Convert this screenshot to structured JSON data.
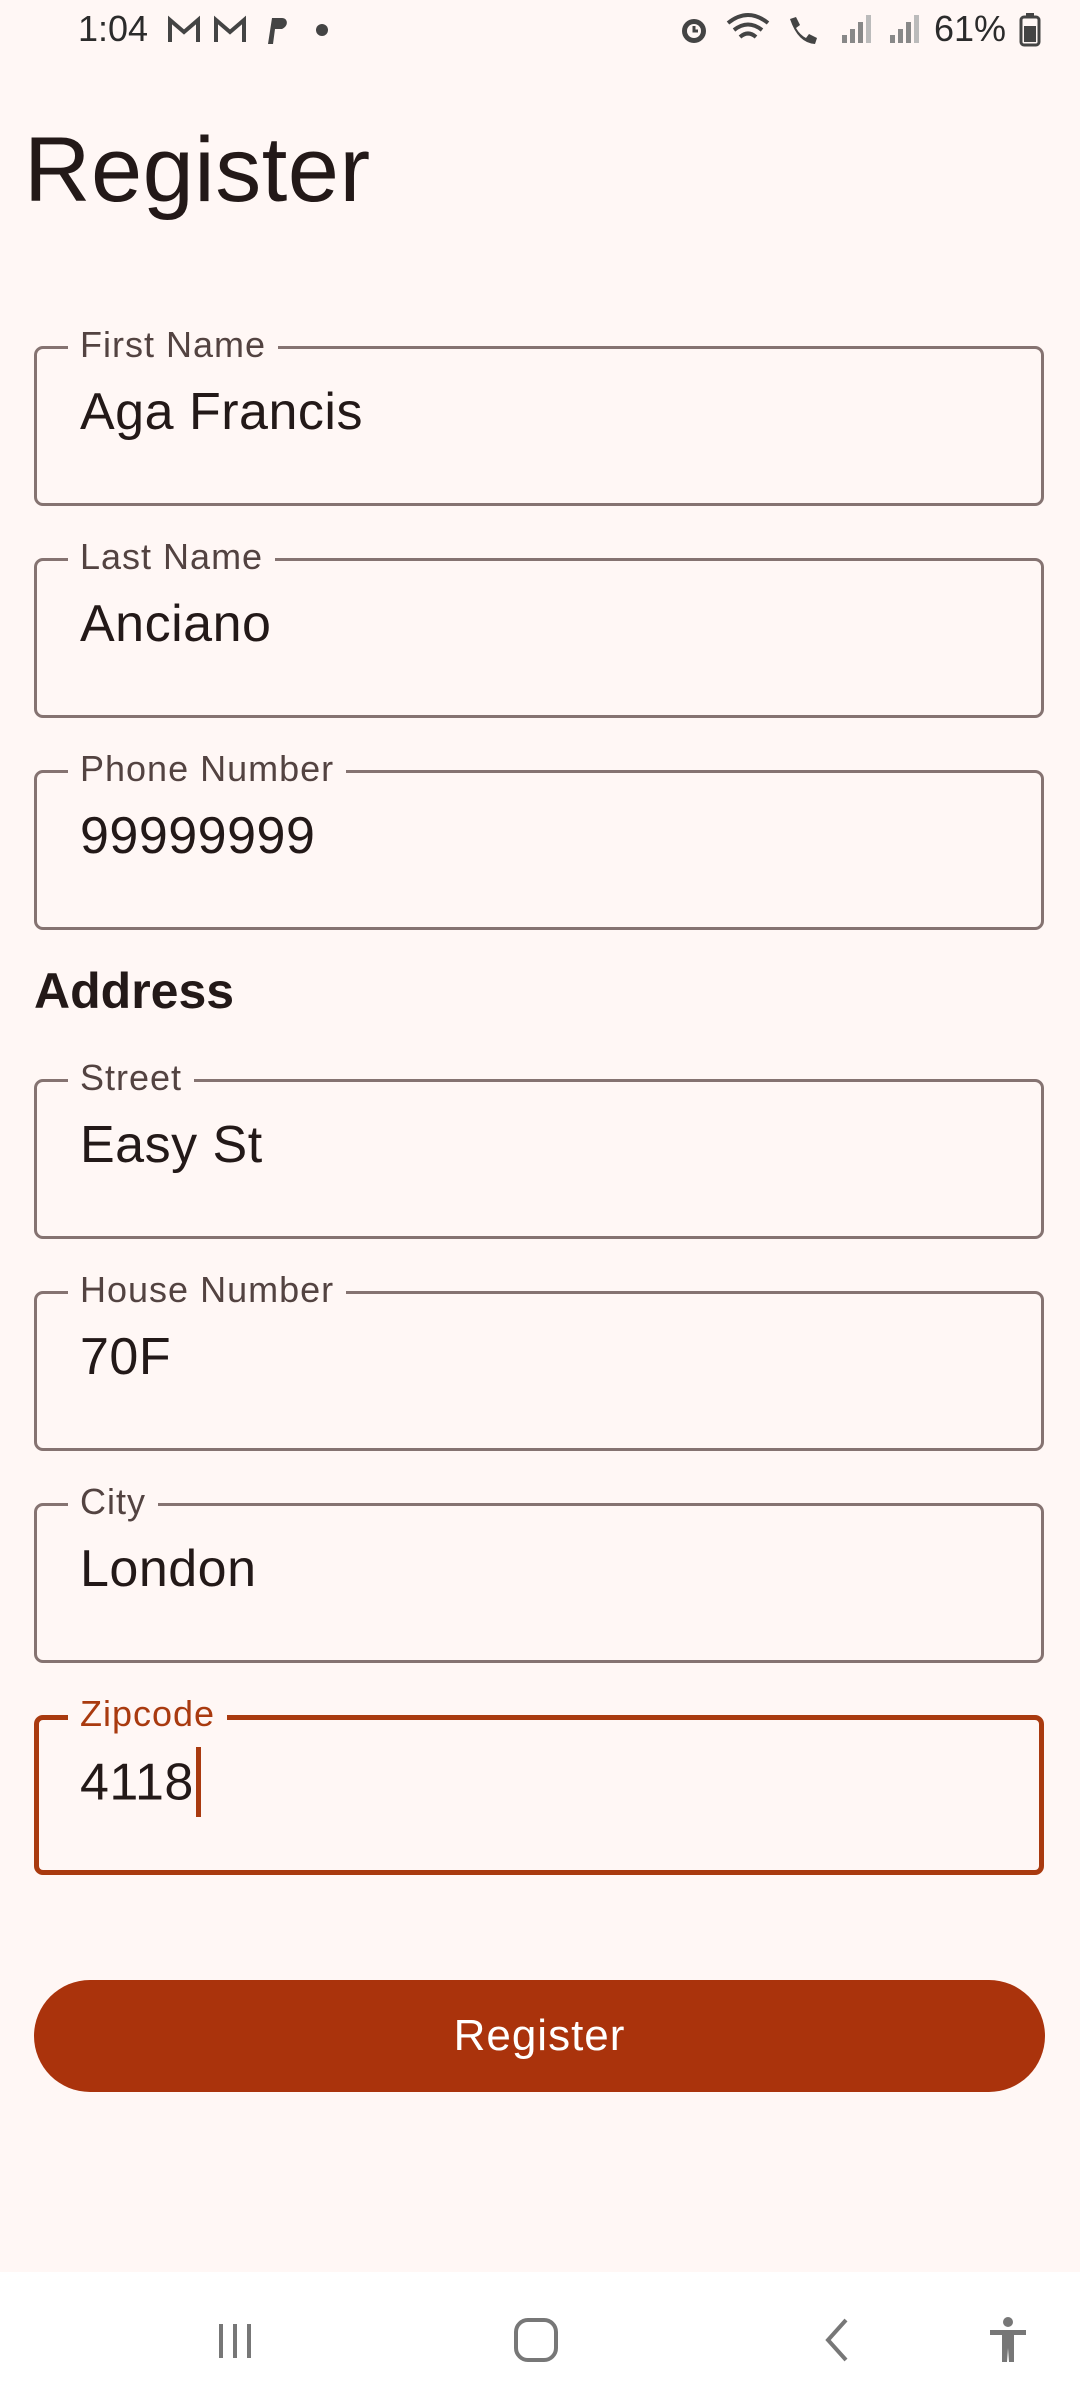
{
  "status_bar": {
    "time": "1:04",
    "battery_percent": "61%",
    "left_icons": [
      "gmail-icon",
      "gmail-icon",
      "paypal-icon",
      "dot-icon"
    ],
    "right_icons": [
      "alarm-icon",
      "wifi-icon",
      "wifi-call-icon",
      "signal-icon",
      "signal-icon",
      "battery-icon"
    ]
  },
  "page": {
    "title": "Register"
  },
  "fields": {
    "first_name": {
      "label": "First Name",
      "value": "Aga Francis"
    },
    "last_name": {
      "label": "Last Name",
      "value": "Anciano"
    },
    "phone": {
      "label": "Phone Number",
      "value": "99999999"
    },
    "street": {
      "label": "Street",
      "value": "Easy St"
    },
    "house_number": {
      "label": "House Number",
      "value": "70F"
    },
    "city": {
      "label": "City",
      "value": "London"
    },
    "zipcode": {
      "label": "Zipcode",
      "value": "4118"
    }
  },
  "address_section": {
    "title": "Address"
  },
  "actions": {
    "register_label": "Register"
  },
  "nav_bar": {
    "icons": [
      "recent-apps-icon",
      "home-icon",
      "back-icon",
      "accessibility-icon"
    ]
  },
  "colors": {
    "background": "#fff7f5",
    "accent": "#aa330c",
    "outline": "#857371",
    "text": "#231918"
  }
}
